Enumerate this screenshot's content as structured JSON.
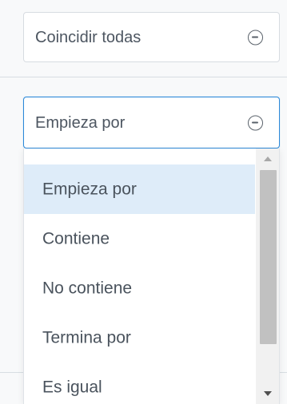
{
  "filters": {
    "match_mode_value": "Coincidir todas",
    "condition_value": "Empieza por"
  },
  "dropdown": {
    "options": [
      {
        "label": "Empieza por",
        "selected": true
      },
      {
        "label": "Contiene",
        "selected": false
      },
      {
        "label": "No contiene",
        "selected": false
      },
      {
        "label": "Termina por",
        "selected": false
      },
      {
        "label": "Es igual",
        "selected": false
      }
    ]
  },
  "icons": {
    "remove_1": "minus-circle-icon",
    "remove_2": "minus-circle-icon",
    "scroll_up": "chevron-up-icon",
    "scroll_down": "chevron-down-icon"
  },
  "colors": {
    "accent": "#2b88d8",
    "selected_option_bg": "#deecf9",
    "scrollbar_track": "#f1f1f1",
    "scrollbar_thumb": "#c1c1c1"
  }
}
